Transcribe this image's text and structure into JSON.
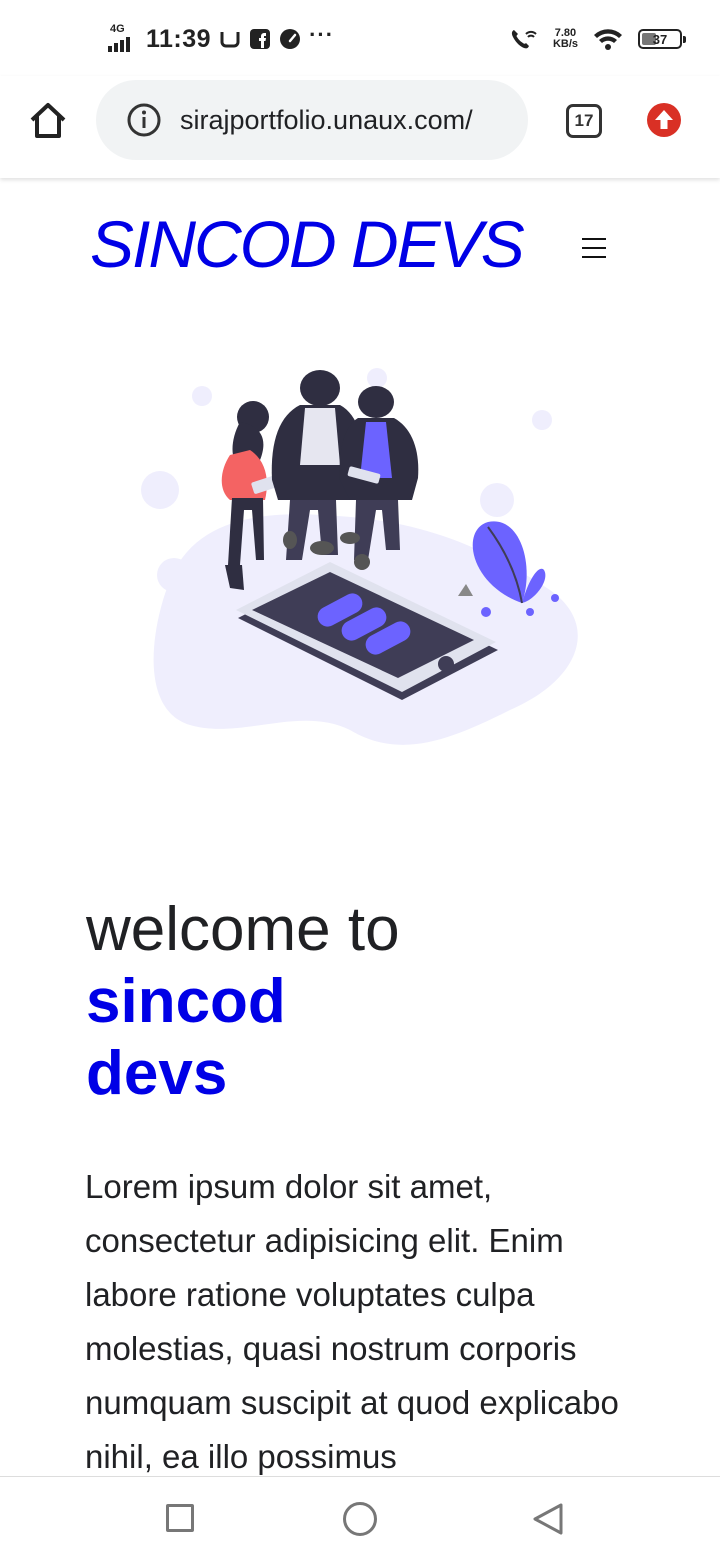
{
  "status_bar": {
    "network": "4G",
    "time": "11:39",
    "overflow": "···",
    "speed_value": "7.80",
    "speed_unit": "KB/s",
    "battery": "37"
  },
  "browser": {
    "url": "sirajportfolio.unaux.com/",
    "tab_count": "17"
  },
  "page": {
    "brand": "SINCOD DEVS",
    "headline_line1": "welcome to",
    "headline_line2": "sincod",
    "headline_line3": "devs",
    "body": "Lorem ipsum dolor sit amet, consectetur adipisicing elit. Enim labore ratione voluptates culpa molestias, quasi nostrum corporis numquam suscipit at quod explicabo nihil, ea illo possimus"
  },
  "colors": {
    "brand": "#0000e6",
    "accent_purple": "#6c63ff",
    "blob": "#efeefd",
    "update_red": "#d93025"
  },
  "icons": {
    "home": "home-icon",
    "info": "info-icon",
    "tabs": "tab-switcher-icon",
    "update": "update-arrow-icon",
    "menu": "hamburger-menu-icon",
    "nav_recent": "square-icon",
    "nav_home": "circle-icon",
    "nav_back": "triangle-back-icon"
  }
}
